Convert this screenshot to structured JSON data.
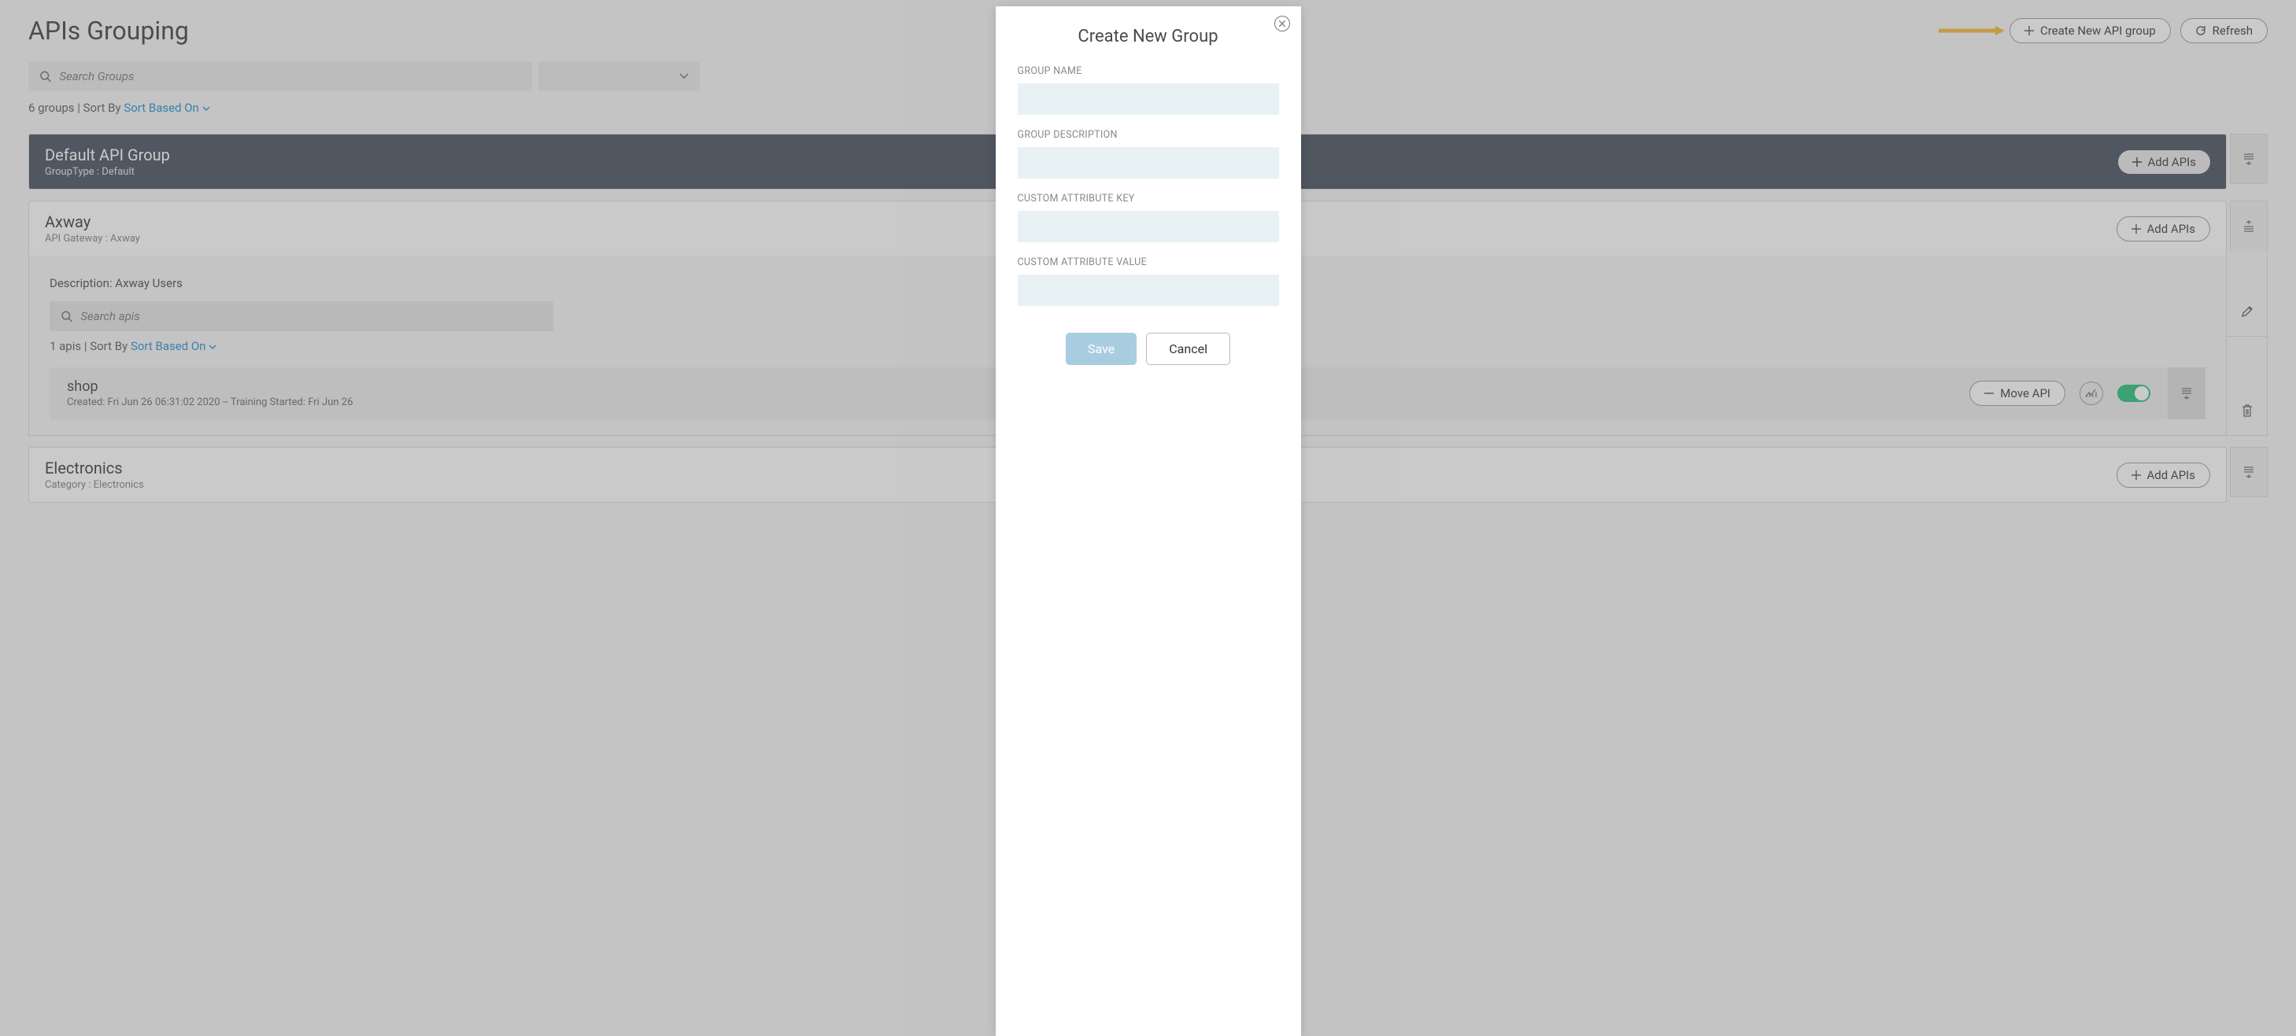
{
  "page": {
    "title": "APIs Grouping",
    "create_btn": "Create New API group",
    "refresh_btn": "Refresh",
    "search_placeholder": "Search Groups",
    "group_count_text": "6 groups | Sort By ",
    "sort_based_on": "Sort Based On"
  },
  "groups": {
    "default": {
      "name": "Default API Group",
      "meta": "GroupType : Default",
      "add_apis": "Add APIs"
    },
    "axway": {
      "name": "Axway",
      "meta": "API Gateway : Axway",
      "description": "Description: Axway Users",
      "add_apis": "Add APIs",
      "search_placeholder": "Search apis",
      "api_count_text": "1 apis | Sort By ",
      "sort_based_on": "Sort Based On",
      "api": {
        "name": "shop",
        "meta": "Created: Fri Jun 26 06:31:02 2020 -- Training Started: Fri Jun 26",
        "move_btn": "Move API"
      }
    },
    "electronics": {
      "name": "Electronics",
      "meta": "Category : Electronics",
      "add_apis": "Add APIs"
    }
  },
  "modal": {
    "title": "Create New Group",
    "labels": {
      "name": "GROUP NAME",
      "desc": "GROUP DESCRIPTION",
      "attr_key": "CUSTOM ATTRIBUTE KEY",
      "attr_val": "CUSTOM ATTRIBUTE VALUE"
    },
    "save": "Save",
    "cancel": "Cancel"
  }
}
